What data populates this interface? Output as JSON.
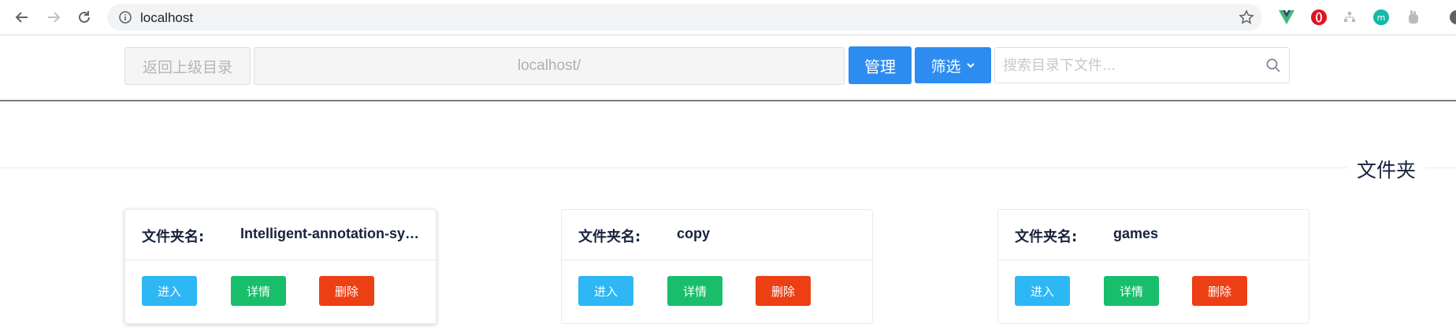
{
  "browser": {
    "url": "localhost",
    "icons": [
      "back-arrow-icon",
      "forward-arrow-icon",
      "reload-icon",
      "site-info-icon",
      "bookmark-star-icon"
    ],
    "extensions": [
      "vue-devtools-icon",
      "opera-extension-icon",
      "gray-extension-icon",
      "teal-extension-icon",
      "hand-extension-icon",
      "profile-avatar-icon"
    ]
  },
  "toolbar": {
    "back_label": "返回上级目录",
    "path": "localhost/",
    "manage_label": "管理",
    "filter_label": "筛选",
    "search_placeholder": "搜索目录下文件..."
  },
  "section": {
    "title": "文件夹"
  },
  "folders": [
    {
      "label": "文件夹名:",
      "name": "Intelligent-annotation-sy…",
      "enter": "进入",
      "detail": "详情",
      "delete": "删除"
    },
    {
      "label": "文件夹名:",
      "name": "copy",
      "enter": "进入",
      "detail": "详情",
      "delete": "删除"
    },
    {
      "label": "文件夹名:",
      "name": "games",
      "enter": "进入",
      "detail": "详情",
      "delete": "删除"
    }
  ],
  "colors": {
    "primary": "#2d8cf0",
    "info": "#2db7f5",
    "success": "#19be6b",
    "error": "#ed3f14"
  }
}
